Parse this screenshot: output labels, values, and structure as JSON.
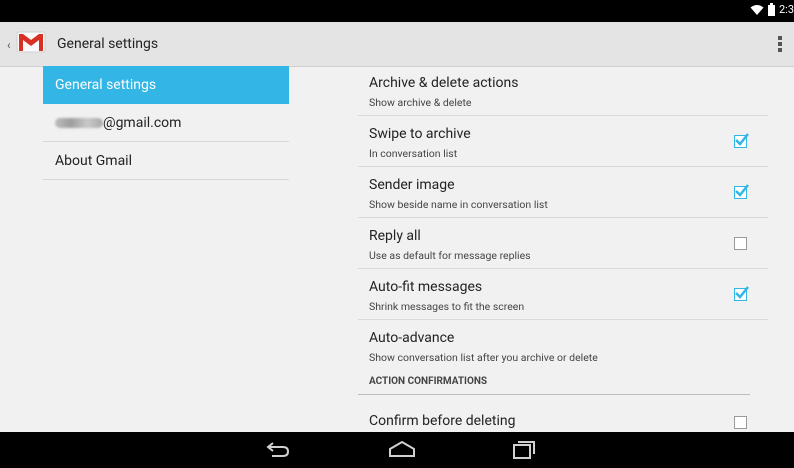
{
  "statusbar": {
    "time": "2:3"
  },
  "actionbar": {
    "title": "General settings"
  },
  "left_nav": {
    "items": [
      {
        "label": "General settings",
        "active": true
      },
      {
        "label": "@gmail.com",
        "redacted": true
      },
      {
        "label": "About Gmail"
      }
    ]
  },
  "preferences": [
    {
      "title": "Archive & delete actions",
      "summary": "Show archive & delete"
    },
    {
      "title": "Swipe to archive",
      "summary": "In conversation list",
      "checked": true
    },
    {
      "title": "Sender image",
      "summary": "Show beside name in conversation list",
      "checked": true
    },
    {
      "title": "Reply all",
      "summary": "Use as default for message replies",
      "checked": false
    },
    {
      "title": "Auto-fit messages",
      "summary": "Shrink messages to fit the screen",
      "checked": true
    },
    {
      "title": "Auto-advance",
      "summary": "Show conversation list after you archive or delete"
    }
  ],
  "category": {
    "label": "ACTION CONFIRMATIONS"
  },
  "confirm": {
    "title": "Confirm before deleting",
    "checked": false
  },
  "colors": {
    "accent": "#33b5e5"
  },
  "icons": [
    "wifi-icon",
    "battery-icon",
    "gmail-icon",
    "overflow-menu-icon",
    "back-icon",
    "home-icon",
    "recents-icon",
    "checkbox-icon"
  ]
}
